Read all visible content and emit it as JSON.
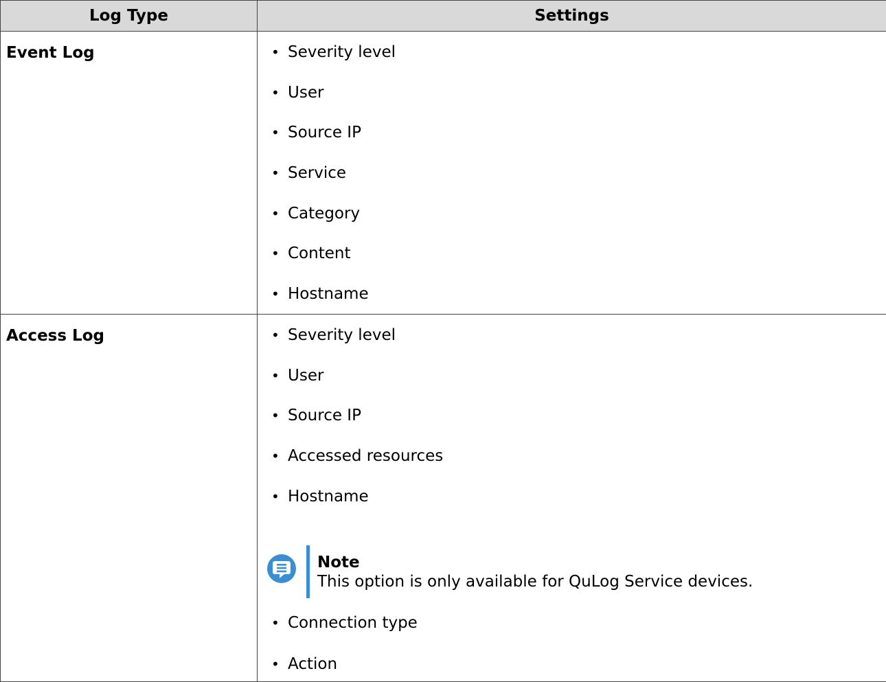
{
  "table": {
    "headers": [
      "Log Type",
      "Settings"
    ],
    "rows": [
      {
        "type": "Event Log",
        "settings": [
          "Severity level",
          "User",
          "Source IP",
          "Service",
          "Category",
          "Content",
          "Hostname"
        ]
      },
      {
        "type": "Access Log",
        "settings_before_note": [
          "Severity level",
          "User",
          "Source IP",
          "Accessed resources",
          "Hostname"
        ],
        "note": {
          "title": "Note",
          "text": "This option is only available for QuLog Service devices."
        },
        "settings_after_note": [
          "Connection type",
          "Action"
        ]
      }
    ]
  },
  "colors": {
    "header_bg": "#d9d9d9",
    "border": "#444444",
    "note_accent": "#3a8ed4"
  },
  "icons": {
    "note": "note-icon",
    "bullet": "bullet-dot"
  }
}
